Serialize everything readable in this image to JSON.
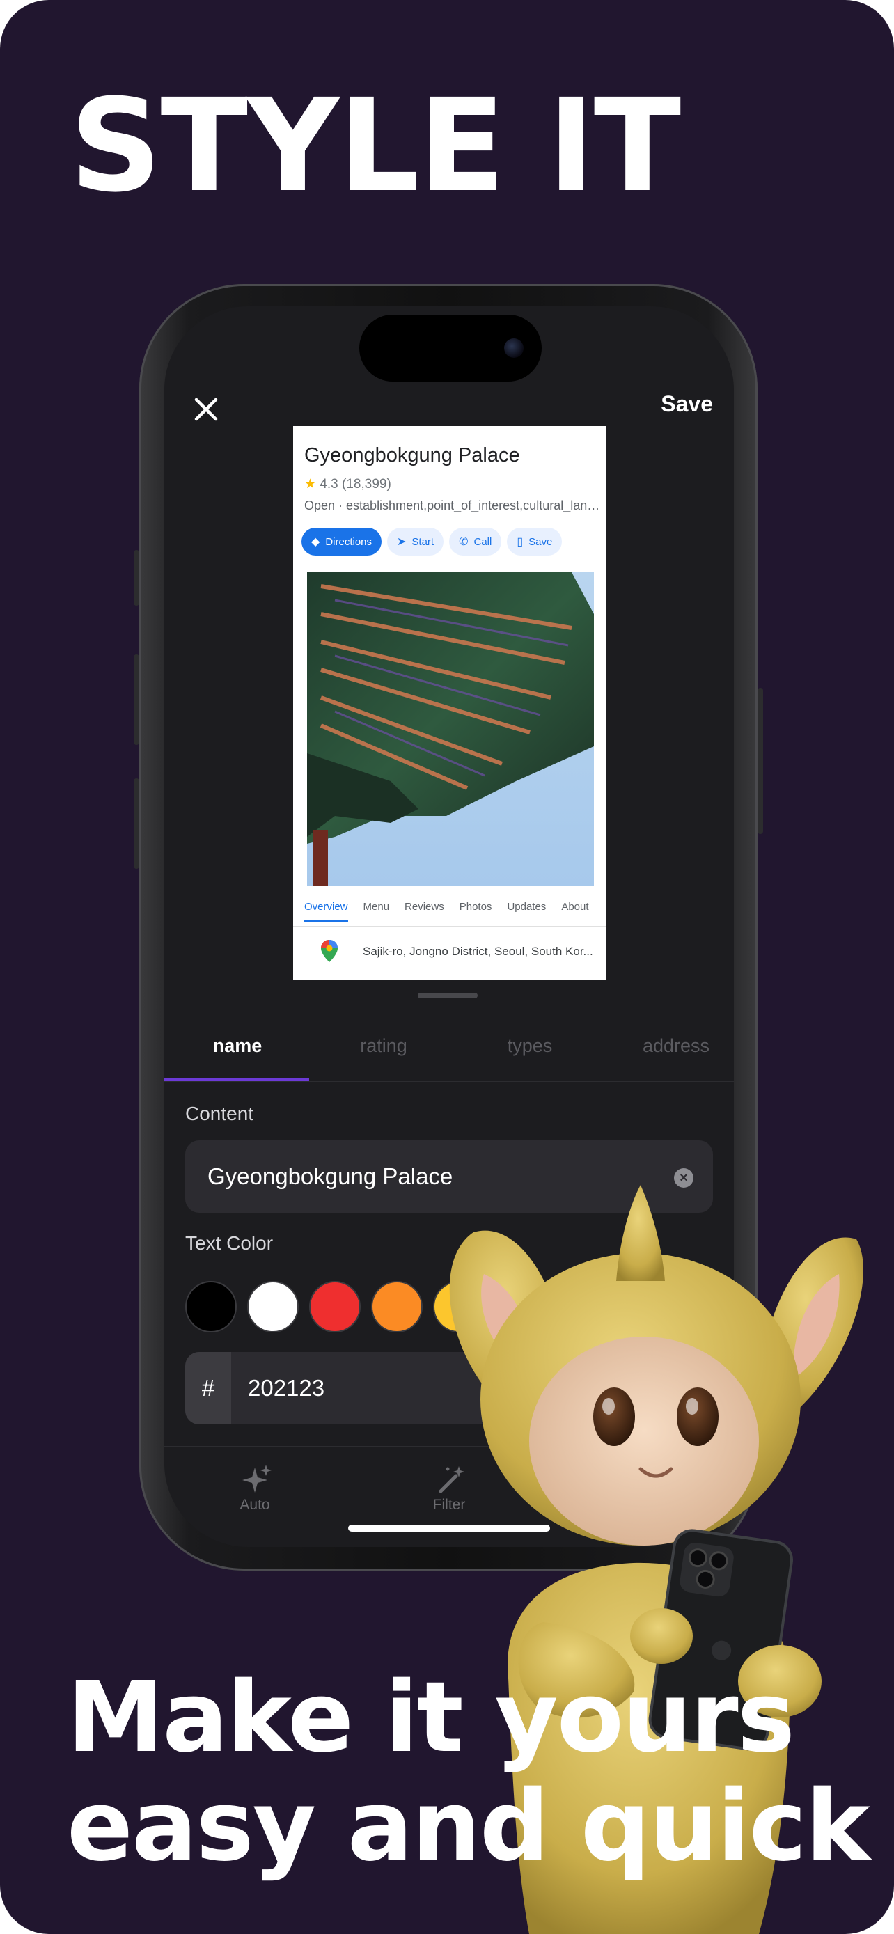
{
  "headline": "STYLE IT",
  "tagline": [
    "Make it yours",
    "easy and quick"
  ],
  "editor": {
    "close_icon": "close-icon",
    "save_label": "Save",
    "preview": {
      "title": "Gyeongbokgung Palace",
      "rating": "4.3",
      "reviews": "(18,399)",
      "subtitle": "Open · establishment,point_of_interest,cultural_land...",
      "actions": [
        "Directions",
        "Start",
        "Call",
        "Save"
      ],
      "tabs": [
        "Overview",
        "Menu",
        "Reviews",
        "Photos",
        "Updates",
        "About"
      ],
      "address": "Sajik-ro, Jongno District, Seoul, South Kor..."
    },
    "field_tabs": [
      "name",
      "rating",
      "types",
      "address"
    ],
    "active_tab": "name",
    "content_label": "Content",
    "content_value": "Gyeongbokgung Palace",
    "text_color_label": "Text Color",
    "swatches": [
      "#000000",
      "#ffffff",
      "#ef2f2f",
      "#fb8b24",
      "#fcc62d",
      "#34c759",
      "#1a6ef5"
    ],
    "hex_prefix": "#",
    "hex_value": "202123",
    "toolbar": [
      {
        "label": "Auto",
        "icon": "sparkles-icon"
      },
      {
        "label": "Filter",
        "icon": "magic-wand-icon"
      }
    ]
  },
  "colors": {
    "background": "#21162f",
    "accent": "#6c3ad6"
  }
}
